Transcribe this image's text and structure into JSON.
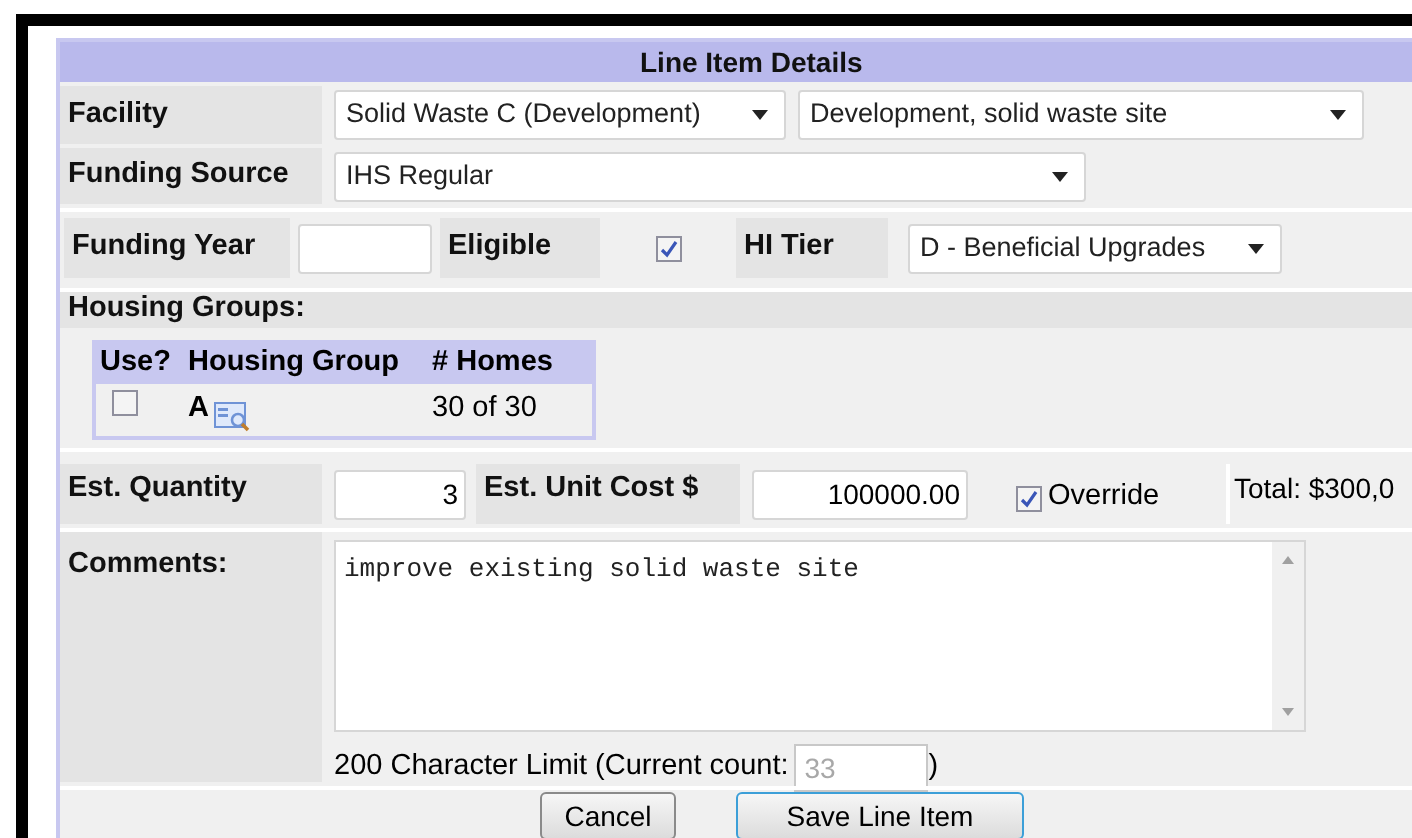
{
  "title": "Line Item Details",
  "facility": {
    "label": "Facility",
    "select_1": "Solid Waste C (Development)",
    "select_2": "Development, solid waste site"
  },
  "funding_source": {
    "label": "Funding Source",
    "select": "IHS Regular"
  },
  "funding_year": {
    "label": "Funding Year"
  },
  "eligible": {
    "label": "Eligible",
    "checked": true
  },
  "hi_tier": {
    "label": "HI Tier",
    "select": "D - Beneficial Upgrades"
  },
  "housing_groups": {
    "label": "Housing Groups:",
    "columns": [
      "Use?",
      "Housing Group",
      "# Homes"
    ],
    "rows": [
      {
        "use": false,
        "group": "A",
        "homes": "30 of 30"
      }
    ]
  },
  "est_quantity": {
    "label": "Est. Quantity",
    "value": "3"
  },
  "est_unit_cost": {
    "label": "Est. Unit Cost $",
    "value": "100000.00"
  },
  "override": {
    "label": "Override",
    "checked": true
  },
  "total": "Total: $300,0",
  "comments": {
    "label": "Comments:",
    "value": "improve existing solid waste site",
    "limit_text": "200 Character Limit (Current count:",
    "count": "33",
    "limit_close": ")"
  },
  "buttons": [
    "Cancel",
    "Save Line Item"
  ]
}
